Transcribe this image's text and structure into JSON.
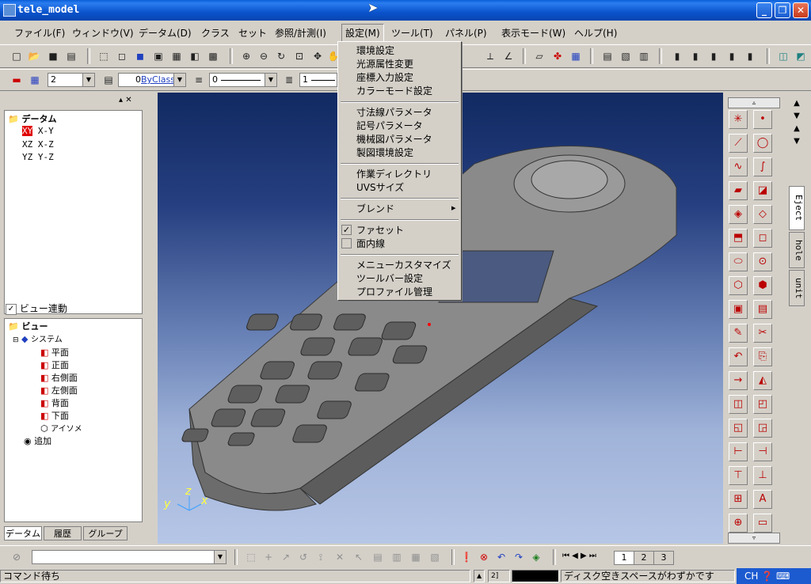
{
  "window": {
    "title": "tele_model",
    "minimize": "_",
    "restore": "❐",
    "close": "✕"
  },
  "menubar": [
    "ファイル(F)",
    "ウィンドウ(V)",
    "データム(D)",
    "クラス",
    "セット",
    "参照/計測(I)",
    "設定(M)",
    "ツール(T)",
    "パネル(P)",
    "表示モード(W)",
    "ヘルプ(H)"
  ],
  "toolbar2": {
    "width_value": "2",
    "layer_value": "0",
    "class_value": "ByClass",
    "linetype_value": "0",
    "line_value": "1"
  },
  "settings_menu": {
    "items": [
      [
        "環境設定",
        "光源属性変更",
        "座標入力設定",
        "カラーモード設定"
      ],
      [
        "寸法線パラメータ",
        "記号パラメータ",
        "機械図パラメータ",
        "製図環境設定"
      ],
      [
        "作業ディレクトリ",
        "UVSサイズ"
      ],
      [
        "ブレンド"
      ],
      [
        "ファセット",
        "面内線"
      ],
      [
        "メニューカスタマイズ",
        "ツールバー設定",
        "プロファイル管理"
      ]
    ],
    "submenu_arrow": "▸",
    "checked": {
      "ファセット": true,
      "面内線": false
    }
  },
  "datum_tree": {
    "root": "データム",
    "items": [
      {
        "code": "XY",
        "label": "X-Y"
      },
      {
        "code": "XZ",
        "label": "X-Z"
      },
      {
        "code": "YZ",
        "label": "Y-Z"
      }
    ]
  },
  "view_link": {
    "label": "ビュー連動",
    "checked": true
  },
  "view_tree": {
    "root": "ビュー",
    "system": "システム",
    "items": [
      "平面",
      "正面",
      "右側面",
      "左側面",
      "背面",
      "下面",
      "アイソメ"
    ],
    "add": "追加"
  },
  "left_tabs": [
    "データム",
    "履歴",
    "グループ"
  ],
  "axis_labels": {
    "y": "y",
    "z": "z",
    "x": "x"
  },
  "side_tabs": [
    "Eject",
    "hole",
    "unit"
  ],
  "palette_icons": [
    "line-star",
    "point",
    "polyline",
    "circle",
    "curve",
    "spline",
    "plane",
    "surface",
    "solid-1",
    "solid-2",
    "revolve",
    "box",
    "cylinder",
    "zoom-solid",
    "cube-1",
    "cube-2",
    "cube-3",
    "document",
    "eraser",
    "split",
    "undo",
    "copy",
    "arrow-bar",
    "cone",
    "cube-4",
    "cube-5",
    "cube-6",
    "cube-7",
    "dim-1",
    "dim-2",
    "dim-3",
    "dim-4",
    "dim-5",
    "abc",
    "target",
    "rect"
  ],
  "page_tabs": [
    "1",
    "2",
    "3"
  ],
  "status": {
    "left": "コマンド待ち",
    "coord": "2]",
    "message": "ディスク空きスペースがわずかです",
    "ime": "CH"
  },
  "colors": {
    "title": "#0a53cc",
    "viewport_top": "#112a62",
    "viewport_bottom": "#b6c6e6",
    "model": "#7a7a7a",
    "highlight": "#ff0000"
  }
}
